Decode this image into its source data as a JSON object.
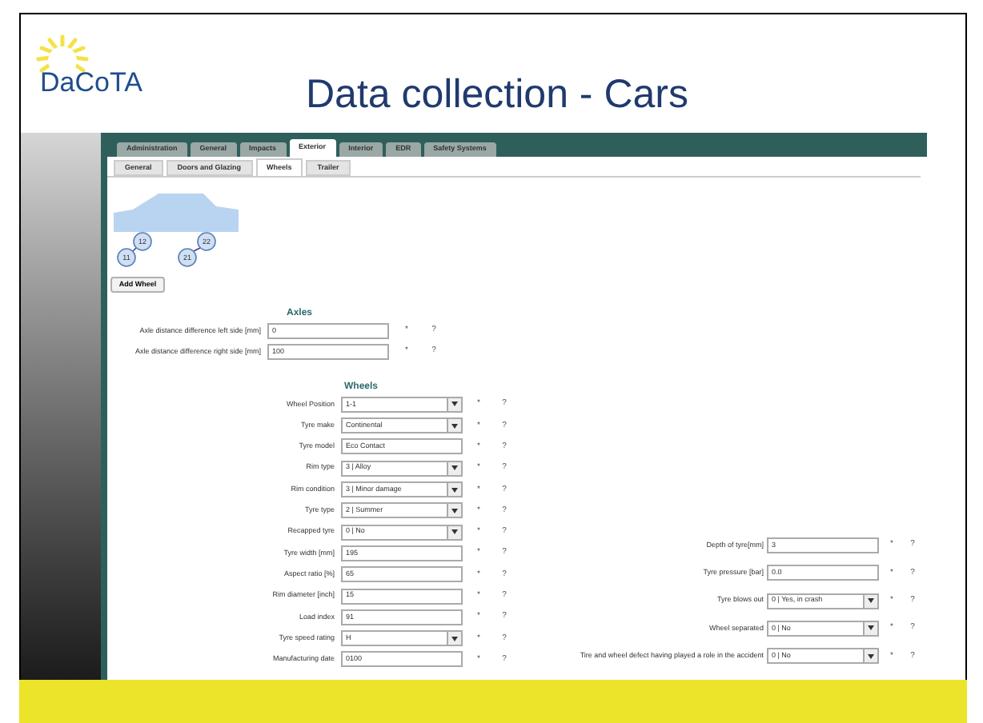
{
  "slide": {
    "logo": "DaCoTA",
    "title": "Data collection - Cars"
  },
  "main_tabs": [
    {
      "label": "Administration",
      "selected": false
    },
    {
      "label": "General",
      "selected": false
    },
    {
      "label": "Impacts",
      "selected": false
    },
    {
      "label": "Exterior",
      "selected": true
    },
    {
      "label": "Interior",
      "selected": false
    },
    {
      "label": "EDR",
      "selected": false
    },
    {
      "label": "Safety Systems",
      "selected": false
    }
  ],
  "sub_tabs": [
    {
      "label": "General",
      "selected": false
    },
    {
      "label": "Doors and Glazing",
      "selected": false
    },
    {
      "label": "Wheels",
      "selected": true
    },
    {
      "label": "Trailer",
      "selected": false
    }
  ],
  "wheel_diagram": {
    "wheels": [
      {
        "label": "11"
      },
      {
        "label": "12"
      },
      {
        "label": "21"
      },
      {
        "label": "22"
      }
    ]
  },
  "add_button": "Add Wheel",
  "axles": {
    "heading": "Axles",
    "fields": [
      {
        "kind": "text",
        "label": "Axle distance difference left side [mm]",
        "value": "0",
        "required_mark": "*",
        "help": "?"
      },
      {
        "kind": "text",
        "label": "Axle distance difference right side [mm]",
        "value": "100",
        "required_mark": "*",
        "help": "?"
      }
    ]
  },
  "wheels": {
    "heading": "Wheels",
    "fields": [
      {
        "kind": "select",
        "label": "Wheel Position",
        "value": "1-1",
        "required_mark": "*",
        "help": "?"
      },
      {
        "kind": "select",
        "label": "Tyre make",
        "value": "Continental",
        "required_mark": "*",
        "help": "?"
      },
      {
        "kind": "text",
        "label": "Tyre model",
        "value": "Eco Contact",
        "required_mark": "*",
        "help": "?"
      },
      {
        "kind": "select",
        "label": "Rim type",
        "value": "3 | Alloy",
        "required_mark": "*",
        "help": "?"
      },
      {
        "kind": "select",
        "label": "Rim condition",
        "value": "3 | Minor damage",
        "required_mark": "*",
        "help": "?"
      },
      {
        "kind": "select",
        "label": "Tyre type",
        "value": "2 | Summer",
        "required_mark": "*",
        "help": "?"
      },
      {
        "kind": "select",
        "label": "Recapped tyre",
        "value": "0 | No",
        "required_mark": "*",
        "help": "?"
      },
      {
        "kind": "text",
        "label": "Tyre width [mm]",
        "value": "195",
        "required_mark": "*",
        "help": "?"
      },
      {
        "kind": "text",
        "label": "Aspect ratio [%]",
        "value": "65",
        "required_mark": "*",
        "help": "?"
      },
      {
        "kind": "text",
        "label": "Rim diameter [inch]",
        "value": "15",
        "required_mark": "*",
        "help": "?"
      },
      {
        "kind": "text",
        "label": "Load index",
        "value": "91",
        "required_mark": "*",
        "help": "?"
      },
      {
        "kind": "select",
        "label": "Tyre speed rating",
        "value": "H",
        "required_mark": "*",
        "help": "?"
      },
      {
        "kind": "text",
        "label": "Manufacturing date",
        "value": "0100",
        "required_mark": "*",
        "help": "?"
      }
    ],
    "fields_right": [
      {
        "kind": "text",
        "label": "Depth of tyre[mm]",
        "value": "3",
        "required_mark": "*",
        "help": "?"
      },
      {
        "kind": "text",
        "label": "Tyre pressure [bar]",
        "value": "0.0",
        "required_mark": "*",
        "help": "?"
      },
      {
        "kind": "select",
        "label": "Tyre blows out",
        "value": "0 | Yes, in crash",
        "required_mark": "*",
        "help": "?"
      },
      {
        "kind": "select",
        "label": "Wheel separated",
        "value": "0 | No",
        "required_mark": "*",
        "help": "?"
      },
      {
        "kind": "select",
        "label": "Tire and wheel defect having played a role in the accident",
        "value": "0 | No",
        "required_mark": "*",
        "help": "?"
      }
    ]
  }
}
